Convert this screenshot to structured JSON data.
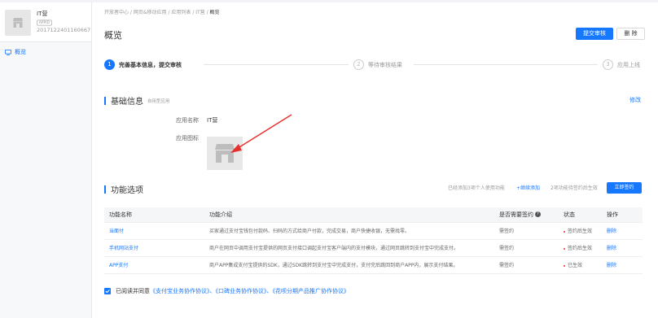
{
  "app": {
    "name": "IT营",
    "tag": "APPID",
    "id": "2017122401160667"
  },
  "sidebar": {
    "items": [
      {
        "label": "概览"
      }
    ]
  },
  "breadcrumb": {
    "items": [
      "开放者中心",
      "网页&移动应用",
      "应用列表",
      "IT营"
    ],
    "current": "概览",
    "separator": " / "
  },
  "header": {
    "title": "概览",
    "submit_label": "提交审核",
    "delete_label": "删 除"
  },
  "steps": [
    {
      "num": "1",
      "label": "完善基本信息，提交审核",
      "active": true
    },
    {
      "num": "2",
      "label": "等待审核结果",
      "active": false
    },
    {
      "num": "3",
      "label": "应用上线",
      "active": false
    }
  ],
  "basic_info": {
    "title": "基础信息",
    "subtitle": "自用型应用",
    "edit_label": "修改",
    "name_label": "应用名称",
    "name_value": "IT营",
    "icon_label": "应用图标"
  },
  "functions": {
    "title": "功能选项",
    "note": "已经添加3项个人使用功能",
    "add_link": "+继续添加",
    "pending_note": "2项功能待签约后生效",
    "sign_button": "立即签约",
    "columns": [
      "功能名称",
      "功能介绍",
      "是否需要签约",
      "状态",
      "操作"
    ],
    "rows": [
      {
        "name": "当面付",
        "desc": "买家通过支付宝钱包付款码、扫码的方式给商户付款，完成交易，商户快捷收银，无需找零。",
        "sign": "需签约",
        "status": "签约后生效",
        "status_color": "#f5222d",
        "action": "删除"
      },
      {
        "name": "手机网站支付",
        "desc": "商户在网页中调用支付宝提供的网页支付接口调起支付宝客户端内的支付模块，通过网页跳转到支付宝中完成支付。",
        "sign": "需签约",
        "status": "签约后生效",
        "status_color": "#f5222d",
        "action": "删除"
      },
      {
        "name": "APP支付",
        "desc": "商户APP集成支付宝提供的SDK，通过SDK跳转到支付宝中完成支付，支付完后跳回到商户APP内，展示支付结果。",
        "sign": "需签约",
        "status": "已生效",
        "status_color": "#f5222d",
        "action": "删除"
      }
    ]
  },
  "agreement": {
    "prefix": "已阅读并同意",
    "links": "《支付宝业务协作协议》、《口碑业务协作协议》、《花呗分期产品推广协作协议》"
  },
  "colors": {
    "accent": "#1677ff",
    "status_red": "#f5222d",
    "arrow_red": "#e8302b"
  }
}
